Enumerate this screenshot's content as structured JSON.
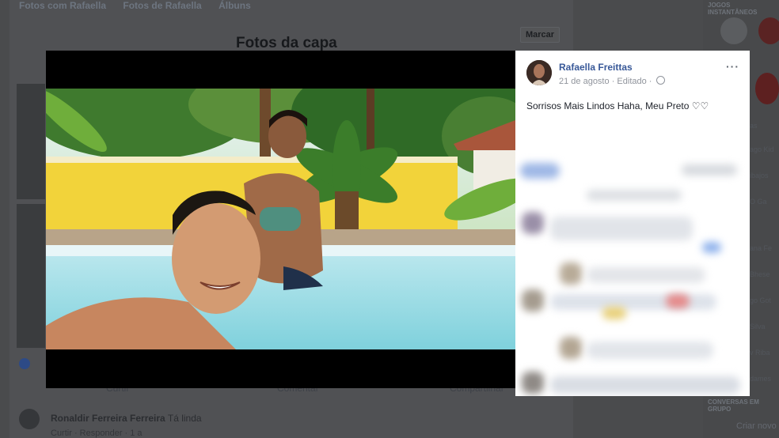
{
  "background": {
    "nav_tabs": [
      "Fotos com Rafaella",
      "Fotos de Rafaella",
      "Álbuns"
    ],
    "album_title": "Fotos da capa",
    "tag_button": "Marcar",
    "actions": [
      "Curtir",
      "Comentar",
      "Compartilhar"
    ],
    "comment_author": "Ronaldir Ferreira Ferreira",
    "comment_text": "Tá linda",
    "comment_meta": "Curtir · Responder · 1 a",
    "right_sidebar_header": "JOGOS INSTANTÂNEOS",
    "right_sidebar_footer": "CONVERSAS EM GRUPO",
    "chat_new": "Criar novo",
    "sidebar_names": [
      "as",
      "ago Kid",
      "ibajos",
      "O Ga",
      "ana Fe",
      "Bhese",
      "go Got",
      "Silva",
      "v Riba",
      "dames"
    ]
  },
  "post": {
    "author": "Rafaella Freittas",
    "date": "21 de agosto",
    "edited": "Editado",
    "separator": "·",
    "caption": "Sorrisos Mais Lindos Haha, Meu Preto ♡♡",
    "more_icon": "···",
    "privacy_icon": "globe-icon"
  },
  "colors": {
    "overlay": "#4a4b4d",
    "theater": "#000000",
    "link": "#385898",
    "meta": "#90949c"
  }
}
